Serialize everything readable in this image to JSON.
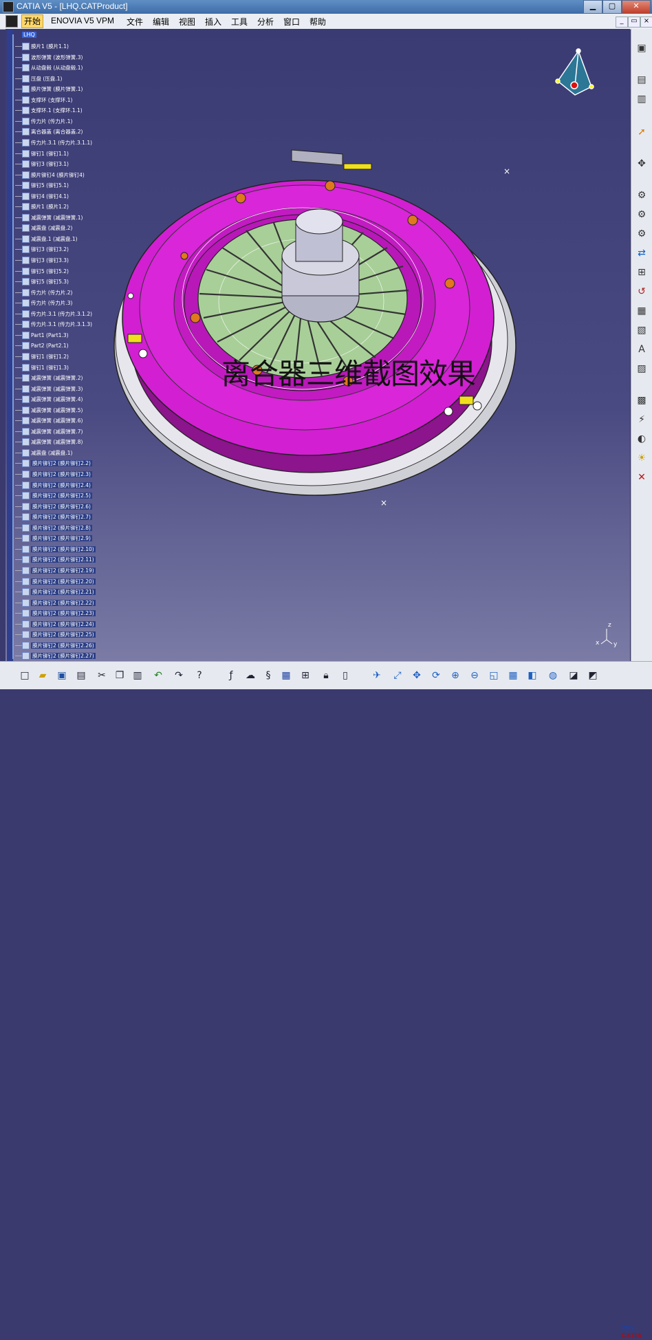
{
  "window": {
    "title": "CATIA V5 - [LHQ.CATProduct]"
  },
  "menubar": {
    "items": [
      "开始",
      "ENOVIA V5 VPM",
      "文件",
      "编辑",
      "视图",
      "插入",
      "工具",
      "分析",
      "窗口",
      "帮助"
    ]
  },
  "tree": {
    "root": "LHQ",
    "items": [
      "膜片1 (膜片1.1)",
      "波形弹簧 (波形弹簧.3)",
      "从动盘毂 (从动盘毂.1)",
      "压盘 (压盘.1)",
      "膜片弹簧 (膜片弹簧.1)",
      "支撑环 (支撑环.1)",
      "支撑环.1 (支撑环.1.1)",
      "传力片 (传力片.1)",
      "离合器盖 (离合器盖.2)",
      "传力片.3.1 (传力片.3.1.1)",
      "铆钉1 (铆钉1.1)",
      "铆钉3 (铆钉3.1)",
      "膜片铆钉4 (膜片铆钉4)",
      "铆钉5 (铆钉5.1)",
      "铆钉4 (铆钉4.1)",
      "膜片1 (膜片1.2)",
      "减震弹簧 (减震弹簧.1)",
      "减震盘 (减震盘.2)",
      "减震盘.1 (减震盘.1)",
      "铆钉3 (铆钉3.2)",
      "铆钉3 (铆钉3.3)",
      "铆钉5 (铆钉5.2)",
      "铆钉5 (铆钉5.3)",
      "传力片 (传力片.2)",
      "传力片 (传力片.3)",
      "传力片.3.1 (传力片.3.1.2)",
      "传力片.3.1 (传力片.3.1.3)",
      "Part1 (Part1.3)",
      "Part2 (Part2.1)",
      "铆钉1 (铆钉1.2)",
      "铆钉1 (铆钉1.3)",
      "减震弹簧 (减震弹簧.2)",
      "减震弹簧 (减震弹簧.3)",
      "减震弹簧 (减震弹簧.4)",
      "减震弹簧 (减震弹簧.5)",
      "减震弹簧 (减震弹簧.6)",
      "减震弹簧 (减震弹簧.7)",
      "减震弹簧 (减震弹簧.8)",
      "减震盘 (减震盘.1)",
      "膜片铆钉2 (膜片铆钉2.2)",
      "膜片铆钉2 (膜片铆钉2.3)",
      "膜片铆钉2 (膜片铆钉2.4)",
      "膜片铆钉2 (膜片铆钉2.5)",
      "膜片铆钉2 (膜片铆钉2.6)",
      "膜片铆钉2 (膜片铆钉2.7)",
      "膜片铆钉2 (膜片铆钉2.8)",
      "膜片铆钉2 (膜片铆钉2.9)",
      "膜片铆钉2 (膜片铆钉2.10)",
      "膜片铆钉2 (膜片铆钉2.11)",
      "膜片铆钉2 (膜片铆钉2.19)",
      "膜片铆钉2 (膜片铆钉2.20)",
      "膜片铆钉2 (膜片铆钉2.21)",
      "膜片铆钉2 (膜片铆钉2.22)",
      "膜片铆钉2 (膜片铆钉2.23)",
      "膜片铆钉2 (膜片铆钉2.24)",
      "膜片铆钉2 (膜片铆钉2.25)",
      "膜片铆钉2 (膜片铆钉2.26)",
      "膜片铆钉2 (膜片铆钉2.27)"
    ]
  },
  "viewport": {
    "overlay_caption": "离合器三维截图效果",
    "compass_axis": "z",
    "triad_labels": [
      "z",
      "x",
      "y"
    ],
    "colors": {
      "cover": "#d21fd2",
      "cover_dark": "#8c148c",
      "disc": "#a8cf98",
      "hub": "#c8c8d8",
      "rivet": "#e0781e",
      "background_top": "#3b3b73",
      "background_bottom": "#7b7ba6"
    }
  },
  "right_toolbar": {
    "icons": [
      "product-icon",
      "edit-icon",
      "snap-icon",
      "select-arrow-icon",
      "move-icon",
      "insert-component-icon",
      "insert-product-icon",
      "insert-part-icon",
      "replace-icon",
      "graph-tree-icon",
      "reorder-icon",
      "multi-instance-icon",
      "manage-icon",
      "text-annotation-icon",
      "publication-icon",
      "scenes-icon",
      "clash-icon",
      "sectioning-icon",
      "light-bulb-icon",
      "no-show-icon"
    ]
  },
  "bottom_toolbar": {
    "icons": [
      "new-icon",
      "open-icon",
      "save-icon",
      "print-icon",
      "cut-icon",
      "copy-icon",
      "paste-icon",
      "undo-icon",
      "redo-icon",
      "whats-this-icon",
      "formula-icon",
      "comment-icon",
      "knowledge-icon",
      "table-icon",
      "graph-icon",
      "lock-icon",
      "catalog-icon",
      "fly-mode-icon",
      "fit-all-icon",
      "pan-icon",
      "rotate-icon",
      "zoom-in-icon",
      "zoom-out-icon",
      "normal-view-icon",
      "multi-view-icon",
      "iso-view-icon",
      "shading-icon",
      "hide-show-icon",
      "swap-visible-icon"
    ],
    "logo_text": "CATIA"
  }
}
